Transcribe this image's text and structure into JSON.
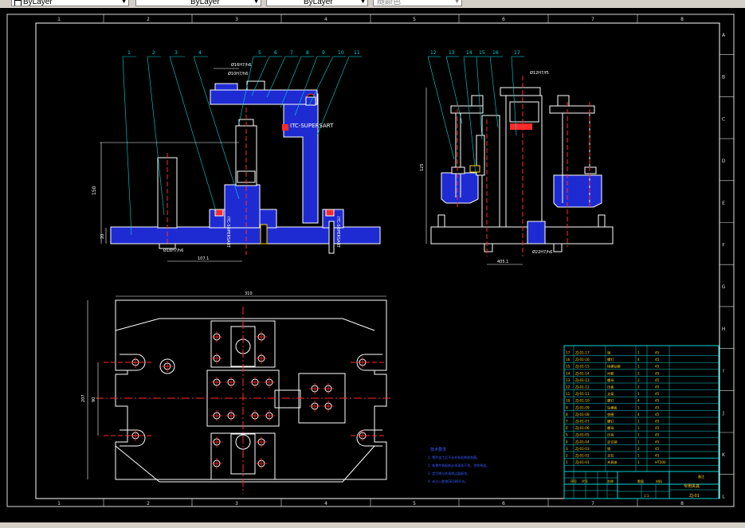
{
  "toolbar": {
    "linetype_label": "ByLayer",
    "lineweight_label": "ByLayer",
    "color_label": "ByLayer",
    "plotstyle_label": "随颜色"
  },
  "frame": {
    "col_labels": [
      "1",
      "2",
      "3",
      "4",
      "5",
      "6",
      "7",
      "8"
    ],
    "row_labels": [
      "A",
      "B",
      "C",
      "D",
      "E",
      "F",
      "G",
      "H",
      "I",
      "J",
      "K",
      "L"
    ]
  },
  "front_view": {
    "balloons": [
      "1",
      "2",
      "3",
      "4",
      "5",
      "6",
      "7",
      "8",
      "9",
      "10",
      "11"
    ],
    "dims": {
      "top_fit_a": "Ø16H7/h6",
      "top_fit_b": "Ø10H7/h6",
      "height": "150",
      "base": "20",
      "bottom_fit": "Ø18H7/h6",
      "offset": "107.1"
    },
    "tag": "ITC-SUPERSART",
    "tag_vertical_a": "ITC-SUPERSART",
    "tag_vertical_b": "ITC-SUPERSART"
  },
  "side_view": {
    "balloons": [
      "12",
      "13",
      "14",
      "15",
      "16",
      "17"
    ],
    "dims": {
      "top_fit": "Ø12H7/f5",
      "height": "125",
      "bottom_fit": "Ø22H7/h6",
      "offset": "405.1"
    }
  },
  "plan_view": {
    "dims": {
      "width": "310",
      "height": "207",
      "inner": "90"
    }
  },
  "notes": {
    "title": "技术要求",
    "lines": [
      "1. 零件加工后不允许有毛刺和划痕。",
      "2. 各零件装配前必须清洗干净，涂防锈油。",
      "3. 定位销与夹具体过盈配合。",
      "4. 未注公差按GB1804-m。"
    ]
  },
  "bom": {
    "rows": [
      [
        "17",
        "ZJ-01-17",
        "销",
        "1",
        "45"
      ],
      [
        "16",
        "ZJ-01-16",
        "螺钉",
        "4",
        "45"
      ],
      [
        "15",
        "ZJ-01-15",
        "快换钻套",
        "1",
        "45"
      ],
      [
        "14",
        "ZJ-01-14",
        "衬套",
        "2",
        "45"
      ],
      [
        "13",
        "ZJ-01-13",
        "螺母",
        "2",
        "45"
      ],
      [
        "12",
        "ZJ-01-12",
        "压板",
        "2",
        "45"
      ],
      [
        "11",
        "ZJ-01-11",
        "支架",
        "1",
        "45"
      ],
      [
        "10",
        "ZJ-01-10",
        "螺钉",
        "4",
        "45"
      ],
      [
        "9",
        "ZJ-01-09",
        "钻模板",
        "1",
        "45"
      ],
      [
        "8",
        "ZJ-01-08",
        "垫圈",
        "4",
        "45"
      ],
      [
        "7",
        "ZJ-01-07",
        "螺钉",
        "1",
        "45"
      ],
      [
        "6",
        "ZJ-01-06",
        "螺母",
        "1",
        "45"
      ],
      [
        "5",
        "ZJ-01-05",
        "压块",
        "1",
        "45"
      ],
      [
        "4",
        "ZJ-01-04",
        "定位销",
        "1",
        "45"
      ],
      [
        "3",
        "ZJ-01-03",
        "销",
        "2",
        "45"
      ],
      [
        "2",
        "ZJ-01-02",
        "支柱",
        "1",
        "45"
      ],
      [
        "1",
        "ZJ-01-01",
        "夹具体",
        "1",
        "HT200"
      ]
    ],
    "header": [
      "序号",
      "代号",
      "名称",
      "数量",
      "材料",
      "备注"
    ],
    "title_block": {
      "drawing_name": "专用夹具",
      "drawing_no": "ZJ-01",
      "scale": "1:1"
    }
  }
}
